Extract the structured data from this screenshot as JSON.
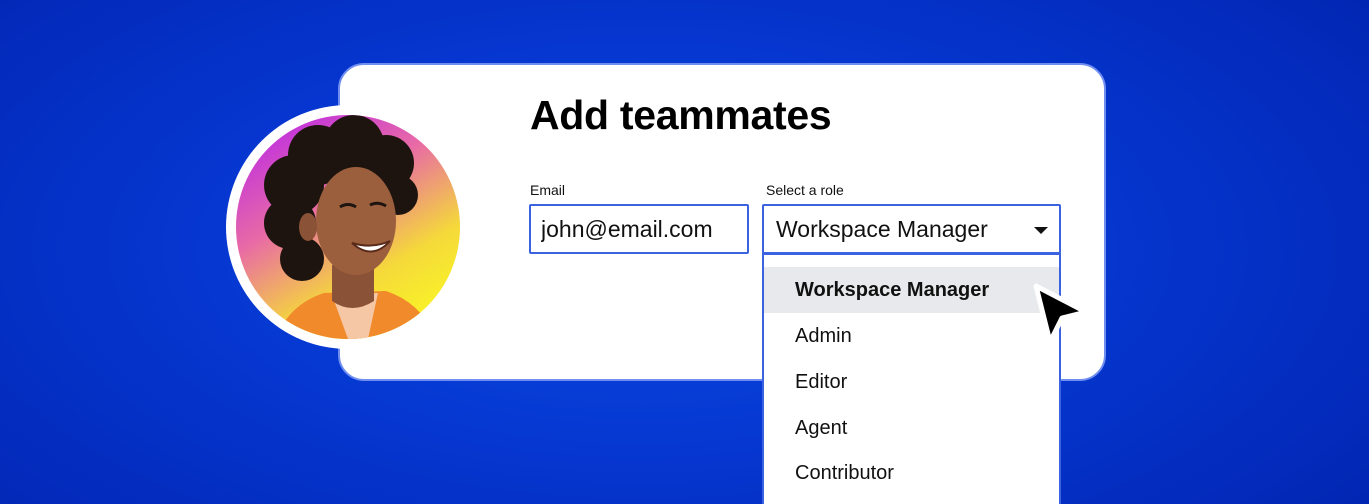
{
  "dialog": {
    "title": "Add teammates"
  },
  "email": {
    "label": "Email",
    "value": "john@email.com"
  },
  "role": {
    "label": "Select a role",
    "selected": "Workspace Manager",
    "options": [
      "Workspace Manager",
      "Admin",
      "Editor",
      "Agent",
      "Contributor"
    ]
  },
  "icons": {
    "caret": "chevron-down-icon",
    "cursor": "mouse-pointer-icon",
    "avatar": "user-avatar"
  },
  "colors": {
    "background": "#0638d2",
    "field_border": "#3b63e0",
    "card_border": "#6f8ef0",
    "selected_option_bg": "#e8e9ec"
  }
}
